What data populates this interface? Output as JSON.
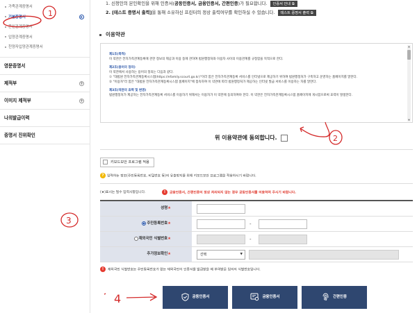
{
  "sidebar": {
    "sub_items": [
      {
        "label": "가족관계증명서",
        "active": false
      },
      {
        "label": "기본증명서",
        "active": true
      },
      {
        "label": "혼인관계증명서",
        "active": false
      },
      {
        "label": "입양관계증명서",
        "active": false
      },
      {
        "label": "친양자입양관계증명서",
        "active": false
      }
    ],
    "main_items": [
      {
        "label": "영문증명서",
        "expandable": false
      },
      {
        "label": "제적부",
        "expandable": true
      },
      {
        "label": "이미지 제적부",
        "expandable": true
      },
      {
        "label": "나의발급이력",
        "expandable": false
      },
      {
        "label": "증명서 진위확인",
        "expandable": false
      }
    ]
  },
  "notices": {
    "line1_pre": "1. 신청인의 본인확인을 위해 인증서(",
    "line1_bold": "공동인증서, 금융인증서, 간편인증",
    "line1_post": ")가 필요합니다.",
    "line1_button": "인증서 안내",
    "line2_bold": "2. [테스트 증명서 출력]",
    "line2_post": "을 통해 소유하신 프린터의 정상 출력여부를 확인하실 수 있습니다.",
    "line2_button": "테스트 증명서 출력"
  },
  "terms": {
    "section_title": "이용약관",
    "articles": [
      {
        "title": "제1조(목적)",
        "paras": [
          "이 약관은 전자가족관계등록에 관한 정보의 제공과 이용 등에 관하여 법원행정처와 이용자 사이의 이용관계를 규정함을 목적으로 한다."
        ]
      },
      {
        "title": "제2조(용어의 정의)",
        "paras": [
          "이 약관에서 사용하는 용어의 정의는 다음과 같다.",
          "① \"대법원 전자가족관계등록시스템(https://efamily.scourt.go.kr)\"이라 함은 전자가족관계등록 서비스를 인터넷으로 제공하기 위하여 법원행정처가 구축하고 운영하는 홈페이지를 말한다.",
          "② \"이용자\"라 함은 \"대법원 전자가족관계등록시스템 홈페이지\"에 접속하여 이 약관에 따라 법원행정처가 제공하는 인터넷 발급 서비스를 이용하는 자를 말한다."
        ]
      },
      {
        "title": "제3조(약관의 효력 및 변경)",
        "paras": [
          "법원행정처가 제공하는 전자가족관계등록 서비스를 이용하기 위해서는 이용자가 이 약관에 동의하여야 한다. 이 약관은 전자가족관계등록시스템 홈페이지에 게시함으로써 효력이 발생한다."
        ]
      }
    ],
    "agree_label": "위 이용약관에 동의합니다."
  },
  "keyboard": {
    "button_label": "키보드보안 프로그램 적용",
    "note": "입력하는 정보(주민등록번호, 비밀번호 등)의 유출방지를 위해 키보드보안 프로그램을 적용하시기 바랍니다."
  },
  "form": {
    "required_note": "(★)표시는 필수 입력사항입니다.",
    "warning": "금융인증서, 간편인증이 정상 처리되지 않는 경우 공동인증서를 이용하여 주시기 바랍니다.",
    "rows": [
      {
        "label": "성명",
        "type": "name"
      },
      {
        "label": "주민등록번호",
        "type": "rrn",
        "radio_on": true
      },
      {
        "label": "재외국민 식별번호",
        "type": "foreign",
        "radio_on": false
      },
      {
        "label": "추가정보확인",
        "type": "extra",
        "select_value": "선택"
      }
    ],
    "foreign_note": "재외국민 식별번호는 주민등록번호가 없는 재외국민이 인증서를 발급받을 때 부여받은 임의의 식별번호입니다."
  },
  "cert_buttons": [
    {
      "label": "공동인증서",
      "icon": "shield-check-icon"
    },
    {
      "label": "금융인증서",
      "icon": "finance-cert-icon"
    },
    {
      "label": "간편인증",
      "icon": "fingerprint-icon"
    }
  ],
  "annotations": [
    "1",
    "2",
    "3",
    "4"
  ],
  "colors": {
    "accent": "#1f4fa8",
    "button": "#2f4770",
    "warning": "#e03a2e",
    "annotation": "#d42a2a"
  }
}
